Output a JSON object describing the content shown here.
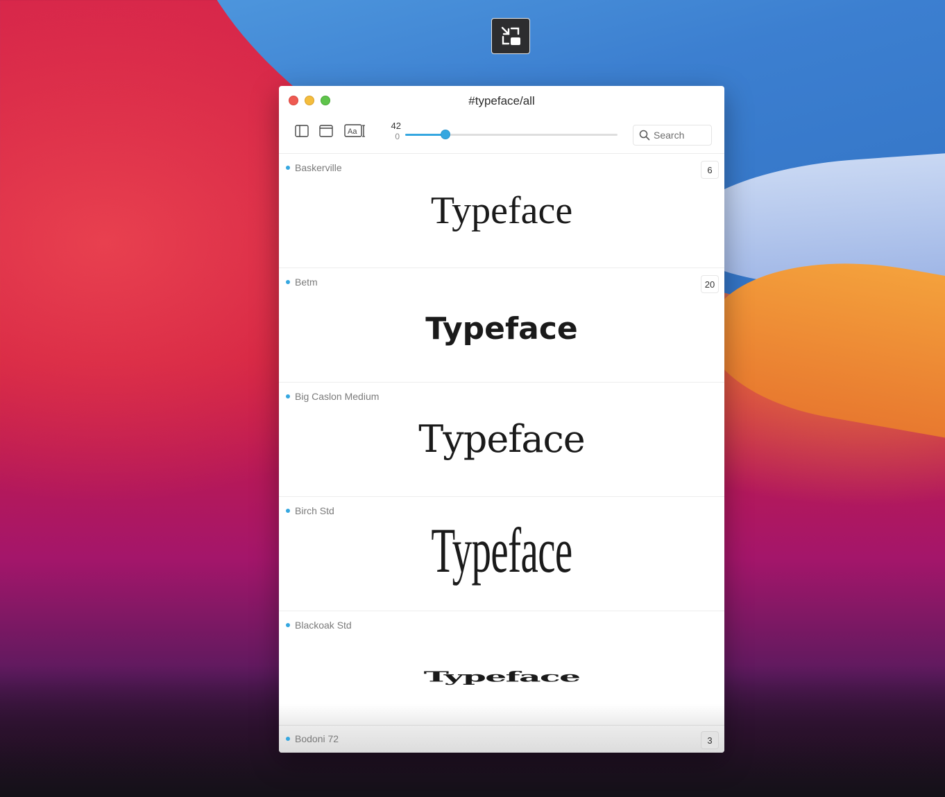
{
  "window": {
    "title": "#typeface/all"
  },
  "toolbar": {
    "sidebar_icon": "sidebar-icon",
    "window_icon": "window-icon",
    "text_icon_label": "Aa",
    "slider_value": "42",
    "slider_min": "0",
    "slider_fraction": 0.19,
    "search_placeholder": "Search"
  },
  "fonts": [
    {
      "name": "Baskerville",
      "sample": "Typeface",
      "count": "6"
    },
    {
      "name": "Betm",
      "sample": "Typeface",
      "count": "20"
    },
    {
      "name": "Big Caslon Medium",
      "sample": "Typeface",
      "count": ""
    },
    {
      "name": "Birch Std",
      "sample": "Typeface",
      "count": ""
    },
    {
      "name": "Blackoak Std",
      "sample": "Typeface",
      "count": ""
    }
  ],
  "footer": {
    "name": "Bodoni 72",
    "count": "3"
  },
  "colors": {
    "accent": "#35a7e0",
    "close": "#ee5a52",
    "minimize": "#f4bd3d",
    "maximize": "#5fc44b"
  }
}
